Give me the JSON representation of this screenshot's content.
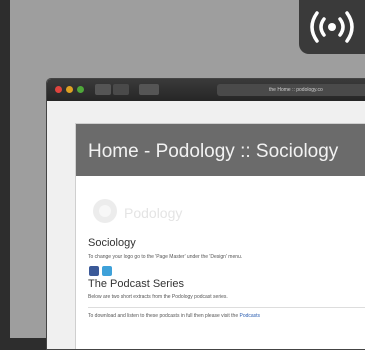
{
  "overlay": {
    "badge_icon": "broadcast-icon",
    "badge_color": "#3a3a3a"
  },
  "browser": {
    "url_text": "the Home :: podology.co",
    "icons": [
      "close-icon",
      "minimize-icon",
      "zoom-icon",
      "back-icon",
      "forward-icon",
      "sidebar-icon"
    ]
  },
  "page": {
    "header_title": "Home - Podology :: Sociology",
    "logo_text": "Podology",
    "section_title": "Sociology",
    "tip_text": "To change your logo go to the 'Page Master' under the 'Design' menu.",
    "social_icons": [
      "facebook-icon",
      "twitter-icon"
    ],
    "podcast_title": "The Podcast Series",
    "podcast_desc": "Below are two short extracts from the Podology podcast series.",
    "download_text": "To download and listen to these podcasts in full then please visit the ",
    "download_link": "Podcasts"
  },
  "colors": {
    "header": "#6b6b6b",
    "facebook": "#3b5998",
    "twitter": "#3ea1d9",
    "link": "#2a5db0"
  }
}
